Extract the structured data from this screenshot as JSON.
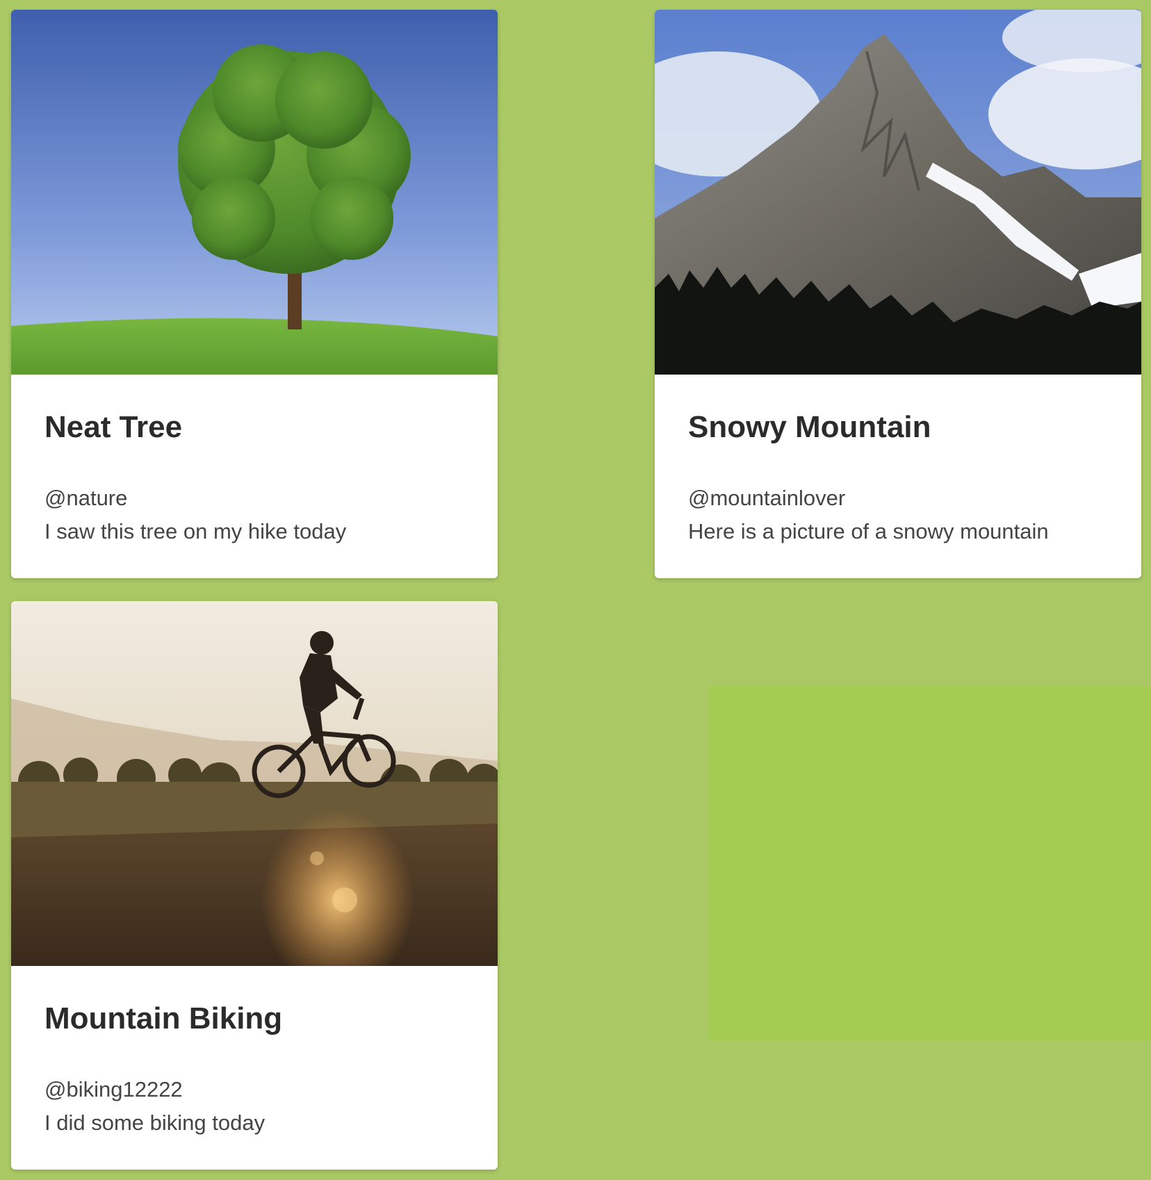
{
  "colors": {
    "page_background": "#aac864",
    "card_background": "#ffffff",
    "highlight_block": "#a4cc52",
    "title_text": "#2b2b2b",
    "body_text": "#444444"
  },
  "cards": [
    {
      "title": "Neat Tree",
      "handle": "@nature",
      "caption": "I saw this tree on my hike today",
      "image_subject": "tree-on-hill-photo"
    },
    {
      "title": "Snowy Mountain",
      "handle": "@mountainlover",
      "caption": "Here is a picture of a snowy mountain",
      "image_subject": "snowy-mountain-photo"
    },
    {
      "title": "Mountain Biking",
      "handle": "@biking12222",
      "caption": "I did some biking today",
      "image_subject": "mountain-biker-photo"
    }
  ]
}
